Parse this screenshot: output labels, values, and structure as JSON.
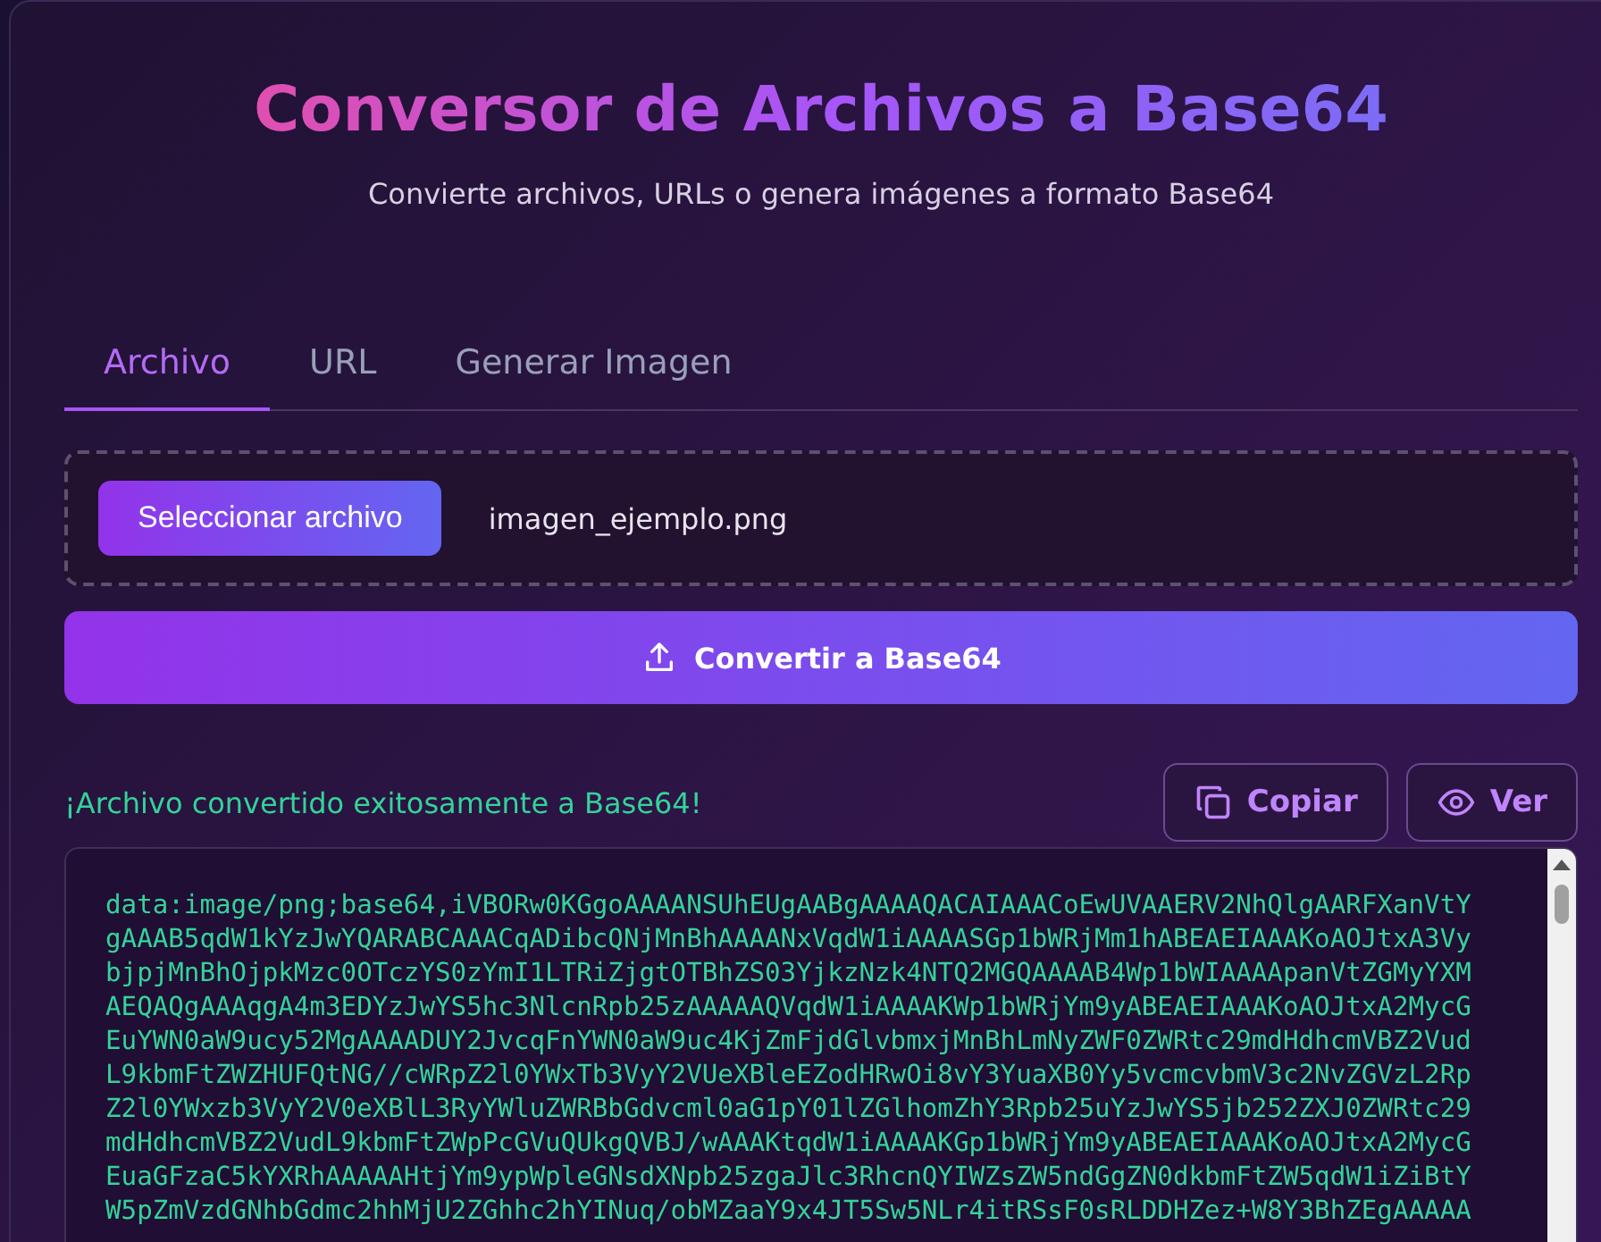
{
  "header": {
    "title": "Conversor de Archivos a Base64",
    "subtitle": "Convierte archivos, URLs o genera imágenes a formato Base64"
  },
  "tabs": [
    {
      "label": "Archivo",
      "selected": true
    },
    {
      "label": "URL",
      "selected": false
    },
    {
      "label": "Generar Imagen",
      "selected": false
    }
  ],
  "file_picker": {
    "button": "Seleccionar archivo",
    "file_name": "imagen_ejemplo.png"
  },
  "convert_button": "Convertir a Base64",
  "result": {
    "message": "¡Archivo convertido exitosamente a Base64!",
    "copy_button": "Copiar",
    "view_button": "Ver",
    "lines": [
      "data:image/png;base64,iVBORw0KGgoAAAANSUhEUgAABgAAAAQACAIAAACoEwUVAAERV2NhQlgAARFXanVtY",
      "gAAAB5qdW1kYzJwYQARABCAAACqADibcQNjMnBhAAAANxVqdW1iAAAASGp1bWRjMm1hABEAEIAAAKoAOJtxA3Vy",
      "bjpjMnBhOjpkMzc0OTczYS0zYmI1LTRiZjgtOTBhZS03YjkzNzk4NTQ2MGQAAAAB4Wp1bWIAAAApanVtZGMyYXM",
      "AEQAQgAAAqgA4m3EDYzJwYS5hc3NlcnRpb25zAAAAAQVqdW1iAAAAKWp1bWRjYm9yABEAEIAAAKoAOJtxA2MycG",
      "EuYWN0aW9ucy52MgAAAADUY2JvcqFnYWN0aW9uc4KjZmFjdGlvbmxjMnBhLmNyZWF0ZWRtc29mdHdhcmVBZ2Vud",
      "L9kbmFtZWZHUFQtNG//cWRpZ2l0YWxTb3VyY2VUeXBleEZodHRwOi8vY3YuaXB0Yy5vcmcvbmV3c2NvZGVzL2Rp",
      "Z2l0YWxzb3VyY2V0eXBlL3RyYWluZWRBbGdvcml0aG1pY01lZGlhomZhY3Rpb25uYzJwYS5jb252ZXJ0ZWRtc29",
      "mdHdhcmVBZ2VudL9kbmFtZWpPcGVuQUkgQVBJ/wAAAKtqdW1iAAAAKGp1bWRjYm9yABEAEIAAAKoAOJtxA2MycG",
      "EuaGFzaC5kYXRhAAAAAHtjYm9ypWpleGNsdXNpb25zgaJlc3RhcnQYIWZsZW5ndGgZN0dkbmFtZW5qdW1iZiBtY",
      "W5pZmVzdGNhbGdmc2hhMjU2ZGhhc2hYINuq/obMZaaY9x4JT5Sw5NLr4itRSsF0sRLDDHZez+W8Y3BhZEgAAAAA"
    ]
  }
}
